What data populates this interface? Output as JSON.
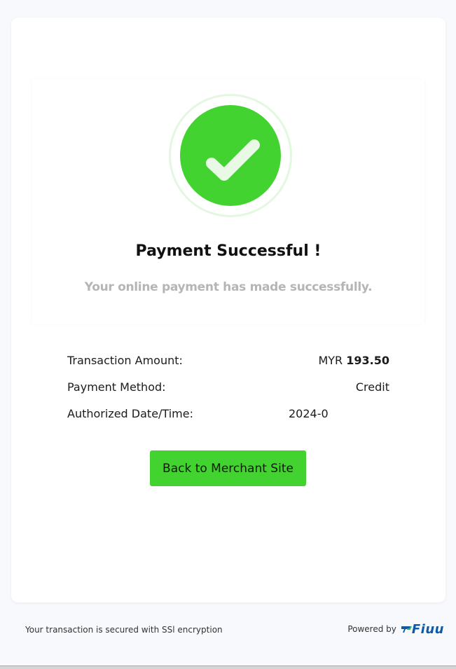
{
  "status": {
    "title": "Payment Successful !",
    "subtitle": "Your online payment has made successfully."
  },
  "details": [
    {
      "label": "Transaction Amount:",
      "currency": "MYR",
      "amount": "193.50"
    },
    {
      "label": "Payment Method:",
      "value": "Credit"
    },
    {
      "label": "Authorized Date/Time:",
      "value": "2024-0"
    }
  ],
  "actions": {
    "back_label": "Back to Merchant Site"
  },
  "footer": {
    "security_note": "Your transaction is secured with SSl encryption",
    "powered_by": "Powered by",
    "brand": "Fiuu"
  },
  "colors": {
    "success": "#42d330",
    "brand": "#0e5aa8"
  },
  "icons": {
    "success": "checkmark-icon",
    "brand_logo": "fiuu-logo"
  }
}
